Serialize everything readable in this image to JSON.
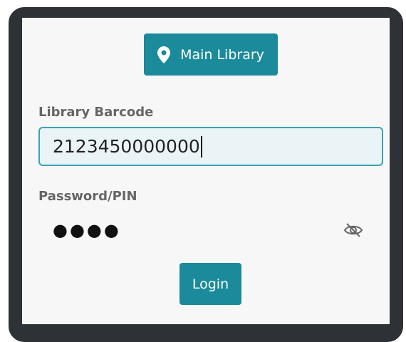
{
  "location": {
    "label": "Main Library",
    "icon": "map-pin-icon"
  },
  "barcode": {
    "label": "Library Barcode",
    "value": "2123450000000"
  },
  "pin": {
    "label": "Password/PIN",
    "masked_value": "●●●●",
    "visibility_icon": "eye-off-icon"
  },
  "login": {
    "label": "Login"
  },
  "colors": {
    "accent": "#1b8a9b",
    "input_border": "#3aa3b3",
    "input_background": "#eaf4f6",
    "frame": "#2e3135"
  }
}
